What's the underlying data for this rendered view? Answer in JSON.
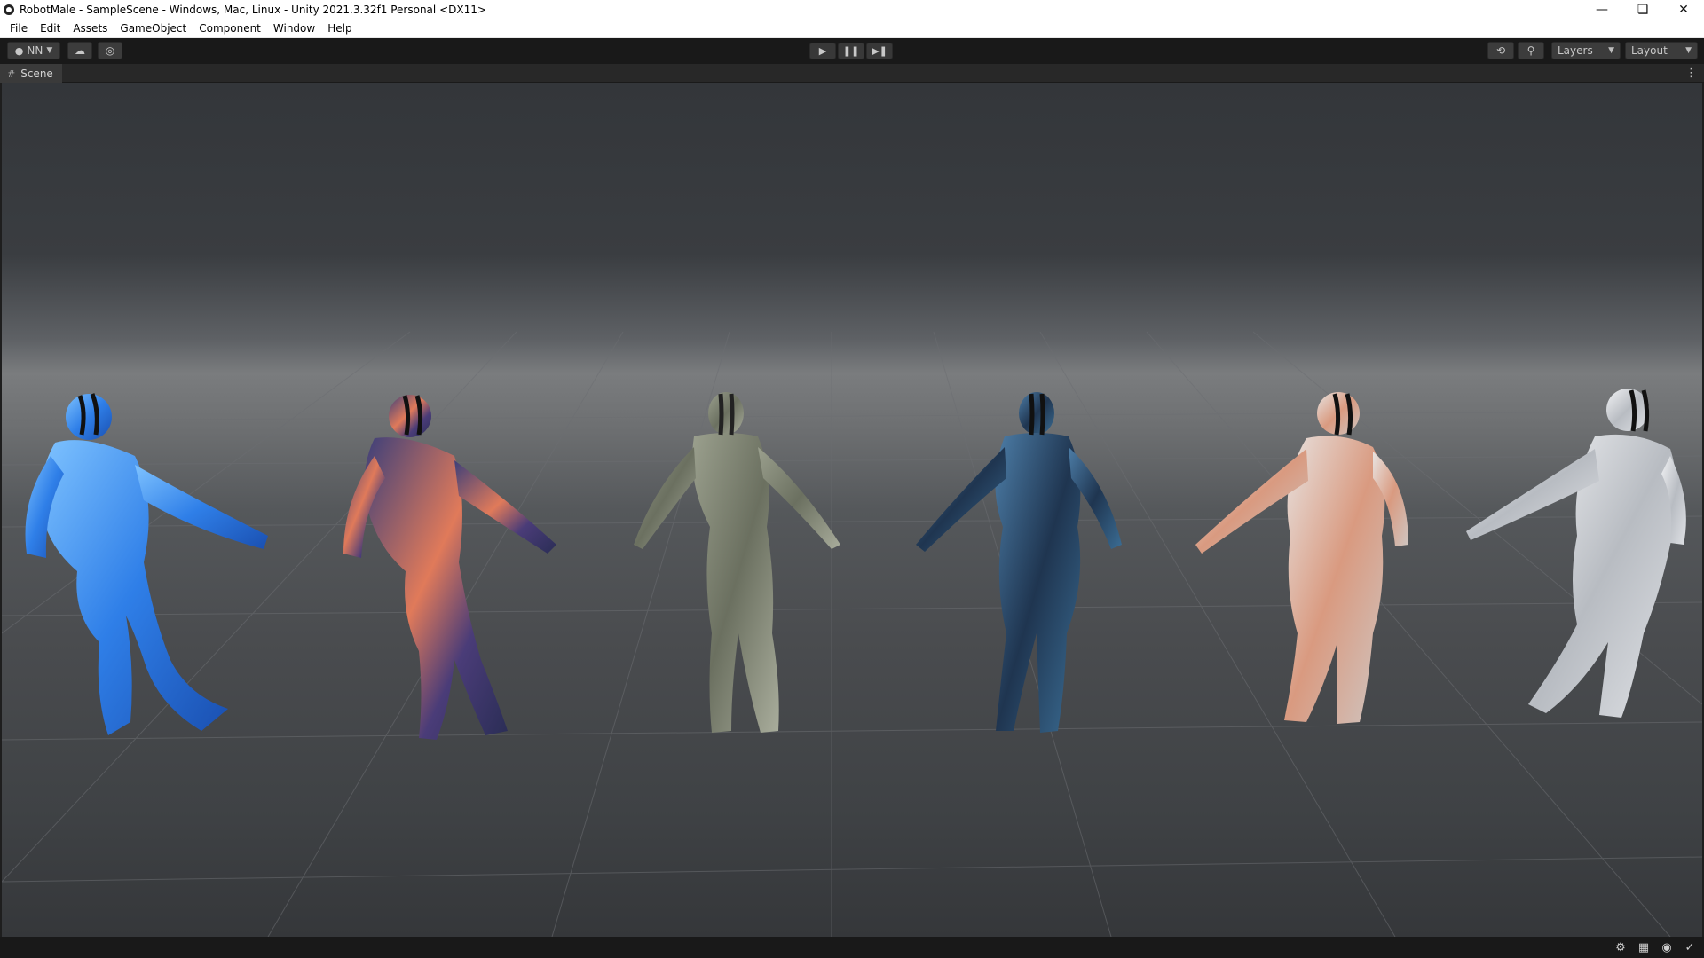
{
  "window": {
    "title": "RobotMale - SampleScene - Windows, Mac, Linux - Unity 2021.3.32f1 Personal <DX11>",
    "minimize_icon": "minimize-icon",
    "maximize_icon": "restore-icon",
    "close_icon": "close-icon"
  },
  "menu": [
    "File",
    "Edit",
    "Assets",
    "GameObject",
    "Component",
    "Window",
    "Help"
  ],
  "toolbar": {
    "account_label": "NN",
    "play_icon": "play-icon",
    "pause_icon": "pause-icon",
    "step_icon": "step-icon",
    "layers_label": "Layers",
    "layout_label": "Layout"
  },
  "scene": {
    "tab_label": "Scene",
    "models": [
      {
        "texture": "blue water",
        "color": "#3d8ff0"
      },
      {
        "texture": "nebula",
        "color": "#5a4a8a"
      },
      {
        "texture": "camouflage",
        "color": "#7d8270"
      },
      {
        "texture": "galaxy",
        "color": "#2e4c6b"
      },
      {
        "texture": "floral",
        "color": "#c9b8ae"
      },
      {
        "texture": "silver",
        "color": "#c6c9cd"
      }
    ]
  },
  "statusbar": {
    "icons": [
      "debug-icon",
      "layout-icon",
      "cache-icon",
      "check-icon"
    ]
  }
}
